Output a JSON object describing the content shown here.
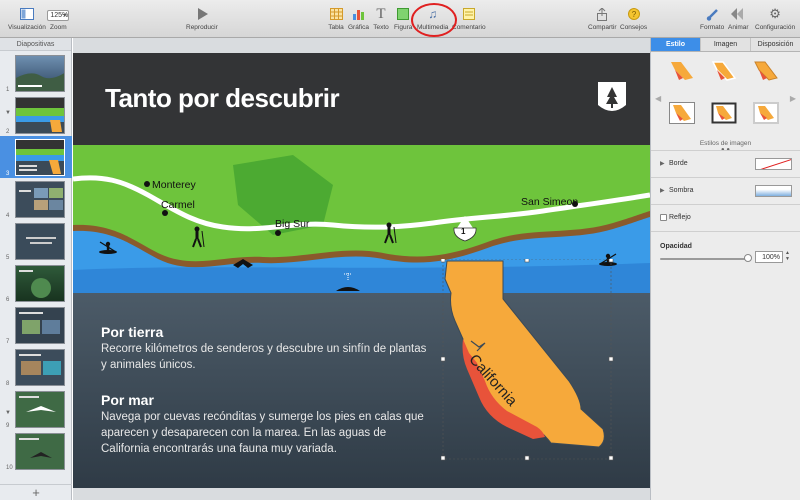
{
  "toolbar": {
    "view_label": "Visualización",
    "zoom_value": "125%",
    "zoom_label": "Zoom",
    "play_label": "Reproducir",
    "table_label": "Tabla",
    "chart_label": "Gráfica",
    "text_label": "Texto",
    "shape_label": "Figura",
    "media_label": "Multimedia",
    "comment_label": "Comentario",
    "share_label": "Compartir",
    "tips_label": "Consejos",
    "format_label": "Formato",
    "animate_label": "Animar",
    "setup_label": "Configuración"
  },
  "navigator": {
    "header": "Diapositivas",
    "slide_numbers": [
      "1",
      "2",
      "3",
      "4",
      "5",
      "6",
      "7",
      "8",
      "9",
      "10"
    ],
    "selected_index": 3
  },
  "slide": {
    "title": "Tanto por descubrir",
    "map_labels": {
      "monterey": "Monterey",
      "carmel": "Carmel",
      "big_sur": "Big Sur",
      "san_simeon": "San Simeon",
      "highway": "1"
    },
    "state_label": "California",
    "section1_title": "Por tierra",
    "section1_text": "Recorre kilómetros de senderos y descubre un sinfín de plantas y animales únicos.",
    "section2_title": "Por mar",
    "section2_text": "Navega por cuevas recónditas y sumerge los pies en calas que aparecen y desaparecen con la marea. En las aguas de California encontrarás una fauna muy variada."
  },
  "inspector": {
    "tabs": [
      "Estilo",
      "Imagen",
      "Disposición"
    ],
    "active_tab": "Estilo",
    "styles_label": "Estilos de imagen",
    "border_label": "Borde",
    "shadow_label": "Sombra",
    "reflection_label": "Reflejo",
    "opacity_label": "Opacidad",
    "opacity_value": "100%",
    "opacity_fraction": 1.0
  },
  "colors": {
    "accent": "#3d8ee8",
    "callout": "#e02020",
    "land_green": "#6ec43c",
    "sea_blue": "#3a9be8",
    "california_orange": "#f6a93b",
    "california_red": "#e8533a"
  }
}
